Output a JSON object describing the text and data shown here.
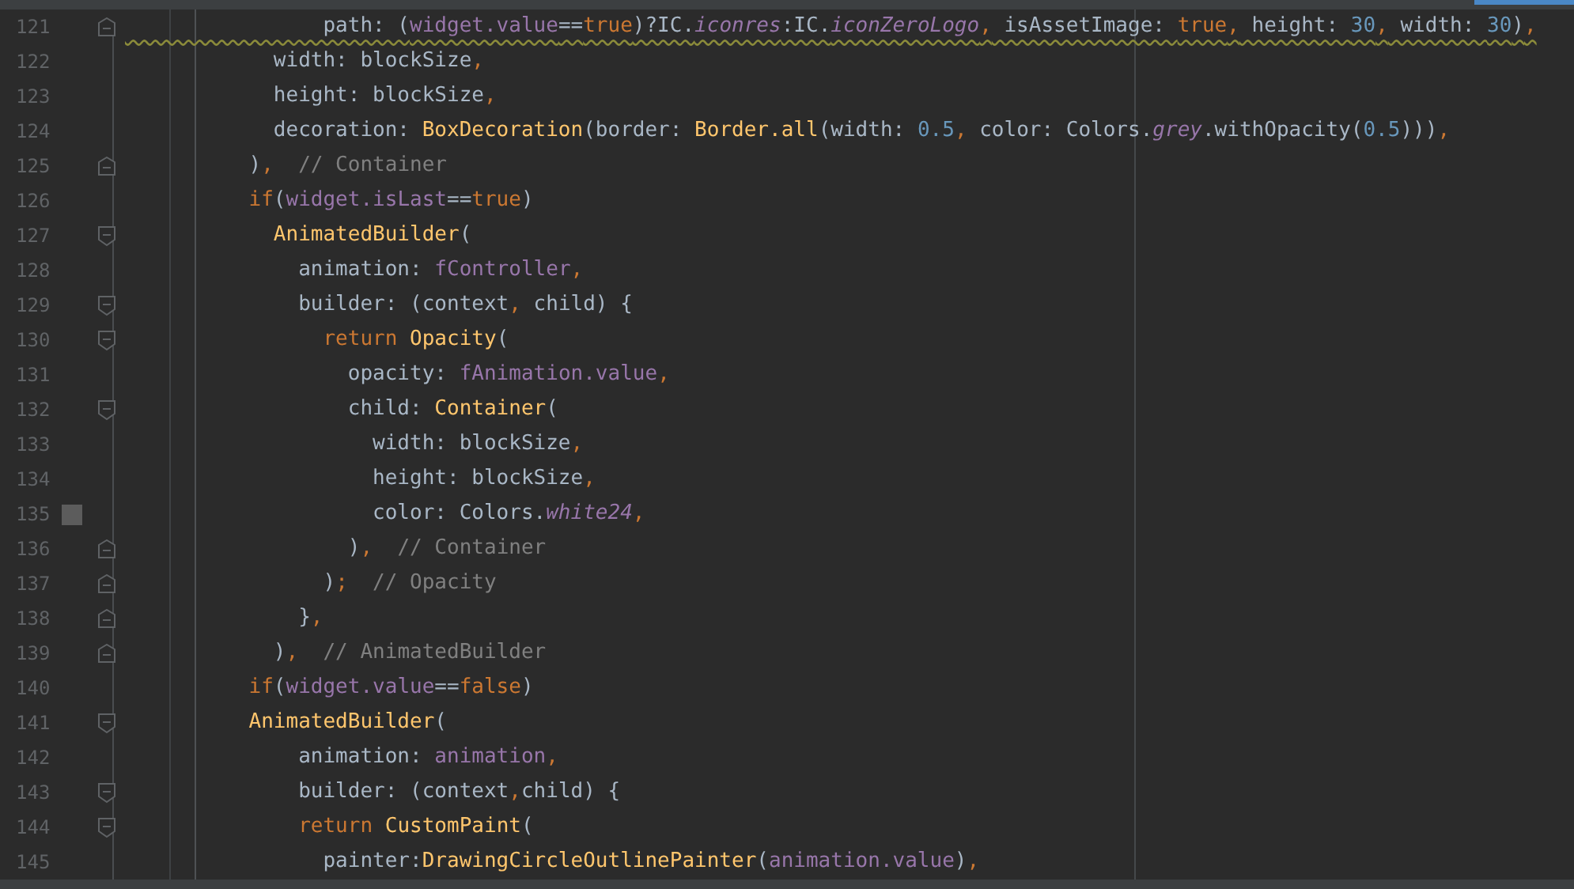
{
  "lines": [
    {
      "number": "121",
      "kind": "fold-end",
      "warning": true,
      "tokens": [
        {
          "text": "                path: (",
          "kind": "plain"
        },
        {
          "text": "widget.value",
          "kind": "field"
        },
        {
          "text": "==",
          "kind": "plain"
        },
        {
          "text": "true",
          "kind": "keyword"
        },
        {
          "text": ")?IC.",
          "kind": "plain"
        },
        {
          "text": "iconres",
          "kind": "static"
        },
        {
          "text": ":IC.",
          "kind": "plain"
        },
        {
          "text": "iconZeroLogo",
          "kind": "static"
        },
        {
          "text": ",",
          "kind": "keyword"
        },
        {
          "text": " isAssetImage: ",
          "kind": "plain"
        },
        {
          "text": "true",
          "kind": "keyword"
        },
        {
          "text": ",",
          "kind": "keyword"
        },
        {
          "text": " height: ",
          "kind": "plain"
        },
        {
          "text": "30",
          "kind": "number"
        },
        {
          "text": ",",
          "kind": "keyword"
        },
        {
          "text": " width: ",
          "kind": "plain"
        },
        {
          "text": "30",
          "kind": "number"
        },
        {
          "text": ")",
          "kind": "plain"
        },
        {
          "text": ",",
          "kind": "keyword"
        }
      ]
    },
    {
      "number": "122",
      "tokens": [
        {
          "text": "            width: blockSize",
          "kind": "plain"
        },
        {
          "text": ",",
          "kind": "keyword"
        }
      ]
    },
    {
      "number": "123",
      "tokens": [
        {
          "text": "            height: blockSize",
          "kind": "plain"
        },
        {
          "text": ",",
          "kind": "keyword"
        }
      ]
    },
    {
      "number": "124",
      "tokens": [
        {
          "text": "            decoration: ",
          "kind": "plain"
        },
        {
          "text": "BoxDecoration",
          "kind": "type"
        },
        {
          "text": "(border: ",
          "kind": "plain"
        },
        {
          "text": "Border.all",
          "kind": "type"
        },
        {
          "text": "(width: ",
          "kind": "plain"
        },
        {
          "text": "0.5",
          "kind": "number"
        },
        {
          "text": ",",
          "kind": "keyword"
        },
        {
          "text": " color: Colors.",
          "kind": "plain"
        },
        {
          "text": "grey",
          "kind": "static"
        },
        {
          "text": ".withOpacity(",
          "kind": "plain"
        },
        {
          "text": "0.5",
          "kind": "number"
        },
        {
          "text": ")))",
          "kind": "plain"
        },
        {
          "text": ",",
          "kind": "keyword"
        }
      ]
    },
    {
      "number": "125",
      "kind": "fold-end",
      "tokens": [
        {
          "text": "          )",
          "kind": "plain"
        },
        {
          "text": ",",
          "kind": "keyword"
        },
        {
          "text": "  // Container",
          "kind": "comment"
        }
      ]
    },
    {
      "number": "126",
      "tokens": [
        {
          "text": "          if",
          "kind": "keyword"
        },
        {
          "text": "(",
          "kind": "plain"
        },
        {
          "text": "widget.isLast",
          "kind": "field"
        },
        {
          "text": "==",
          "kind": "plain"
        },
        {
          "text": "true",
          "kind": "keyword"
        },
        {
          "text": ")",
          "kind": "plain"
        }
      ]
    },
    {
      "number": "127",
      "kind": "fold-start",
      "tokens": [
        {
          "text": "            AnimatedBuilder",
          "kind": "type"
        },
        {
          "text": "(",
          "kind": "plain"
        }
      ]
    },
    {
      "number": "128",
      "tokens": [
        {
          "text": "              animation: ",
          "kind": "plain"
        },
        {
          "text": "fController",
          "kind": "field"
        },
        {
          "text": ",",
          "kind": "keyword"
        }
      ]
    },
    {
      "number": "129",
      "kind": "fold-start",
      "tokens": [
        {
          "text": "              builder: (context",
          "kind": "plain"
        },
        {
          "text": ",",
          "kind": "keyword"
        },
        {
          "text": " child) {",
          "kind": "plain"
        }
      ]
    },
    {
      "number": "130",
      "kind": "fold-start",
      "tokens": [
        {
          "text": "                return ",
          "kind": "keyword"
        },
        {
          "text": "Opacity",
          "kind": "type"
        },
        {
          "text": "(",
          "kind": "plain"
        }
      ]
    },
    {
      "number": "131",
      "tokens": [
        {
          "text": "                  opacity: ",
          "kind": "plain"
        },
        {
          "text": "fAnimation.value",
          "kind": "field"
        },
        {
          "text": ",",
          "kind": "keyword"
        }
      ]
    },
    {
      "number": "132",
      "kind": "fold-start",
      "tokens": [
        {
          "text": "                  child: ",
          "kind": "plain"
        },
        {
          "text": "Container",
          "kind": "type"
        },
        {
          "text": "(",
          "kind": "plain"
        }
      ]
    },
    {
      "number": "133",
      "tokens": [
        {
          "text": "                    width: blockSize",
          "kind": "plain"
        },
        {
          "text": ",",
          "kind": "keyword"
        }
      ]
    },
    {
      "number": "134",
      "tokens": [
        {
          "text": "                    height: blockSize",
          "kind": "plain"
        },
        {
          "text": ",",
          "kind": "keyword"
        }
      ]
    },
    {
      "number": "135",
      "color": "#5c5c5c",
      "tokens": [
        {
          "text": "                    color: Colors.",
          "kind": "plain"
        },
        {
          "text": "white24",
          "kind": "static"
        },
        {
          "text": ",",
          "kind": "keyword"
        }
      ]
    },
    {
      "number": "136",
      "kind": "fold-end",
      "tokens": [
        {
          "text": "                  )",
          "kind": "plain"
        },
        {
          "text": ",",
          "kind": "keyword"
        },
        {
          "text": "  // Container",
          "kind": "comment"
        }
      ]
    },
    {
      "number": "137",
      "kind": "fold-end",
      "tokens": [
        {
          "text": "                )",
          "kind": "plain"
        },
        {
          "text": ";",
          "kind": "keyword"
        },
        {
          "text": "  // Opacity",
          "kind": "comment"
        }
      ]
    },
    {
      "number": "138",
      "kind": "fold-end",
      "tokens": [
        {
          "text": "              }",
          "kind": "plain"
        },
        {
          "text": ",",
          "kind": "keyword"
        }
      ]
    },
    {
      "number": "139",
      "kind": "fold-end",
      "tokens": [
        {
          "text": "            )",
          "kind": "plain"
        },
        {
          "text": ",",
          "kind": "keyword"
        },
        {
          "text": "  // AnimatedBuilder",
          "kind": "comment"
        }
      ]
    },
    {
      "number": "140",
      "tokens": [
        {
          "text": "          if",
          "kind": "keyword"
        },
        {
          "text": "(",
          "kind": "plain"
        },
        {
          "text": "widget.value",
          "kind": "field"
        },
        {
          "text": "==",
          "kind": "plain"
        },
        {
          "text": "false",
          "kind": "keyword"
        },
        {
          "text": ")",
          "kind": "plain"
        }
      ]
    },
    {
      "number": "141",
      "kind": "fold-start",
      "tokens": [
        {
          "text": "          AnimatedBuilder",
          "kind": "type"
        },
        {
          "text": "(",
          "kind": "plain"
        }
      ]
    },
    {
      "number": "142",
      "tokens": [
        {
          "text": "              animation: ",
          "kind": "plain"
        },
        {
          "text": "animation",
          "kind": "field"
        },
        {
          "text": ",",
          "kind": "keyword"
        }
      ]
    },
    {
      "number": "143",
      "kind": "fold-start",
      "tokens": [
        {
          "text": "              builder: (context",
          "kind": "plain"
        },
        {
          "text": ",",
          "kind": "keyword"
        },
        {
          "text": "child) {",
          "kind": "plain"
        }
      ]
    },
    {
      "number": "144",
      "kind": "fold-start",
      "tokens": [
        {
          "text": "              return ",
          "kind": "keyword"
        },
        {
          "text": "CustomPaint",
          "kind": "type"
        },
        {
          "text": "(",
          "kind": "plain"
        }
      ]
    },
    {
      "number": "145",
      "tokens": [
        {
          "text": "                painter:",
          "kind": "plain"
        },
        {
          "text": "DrawingCircleOutlinePainter",
          "kind": "type"
        },
        {
          "text": "(",
          "kind": "plain"
        },
        {
          "text": "animation.value",
          "kind": "field"
        },
        {
          "text": ")",
          "kind": "plain"
        },
        {
          "text": ",",
          "kind": "keyword"
        }
      ]
    }
  ]
}
